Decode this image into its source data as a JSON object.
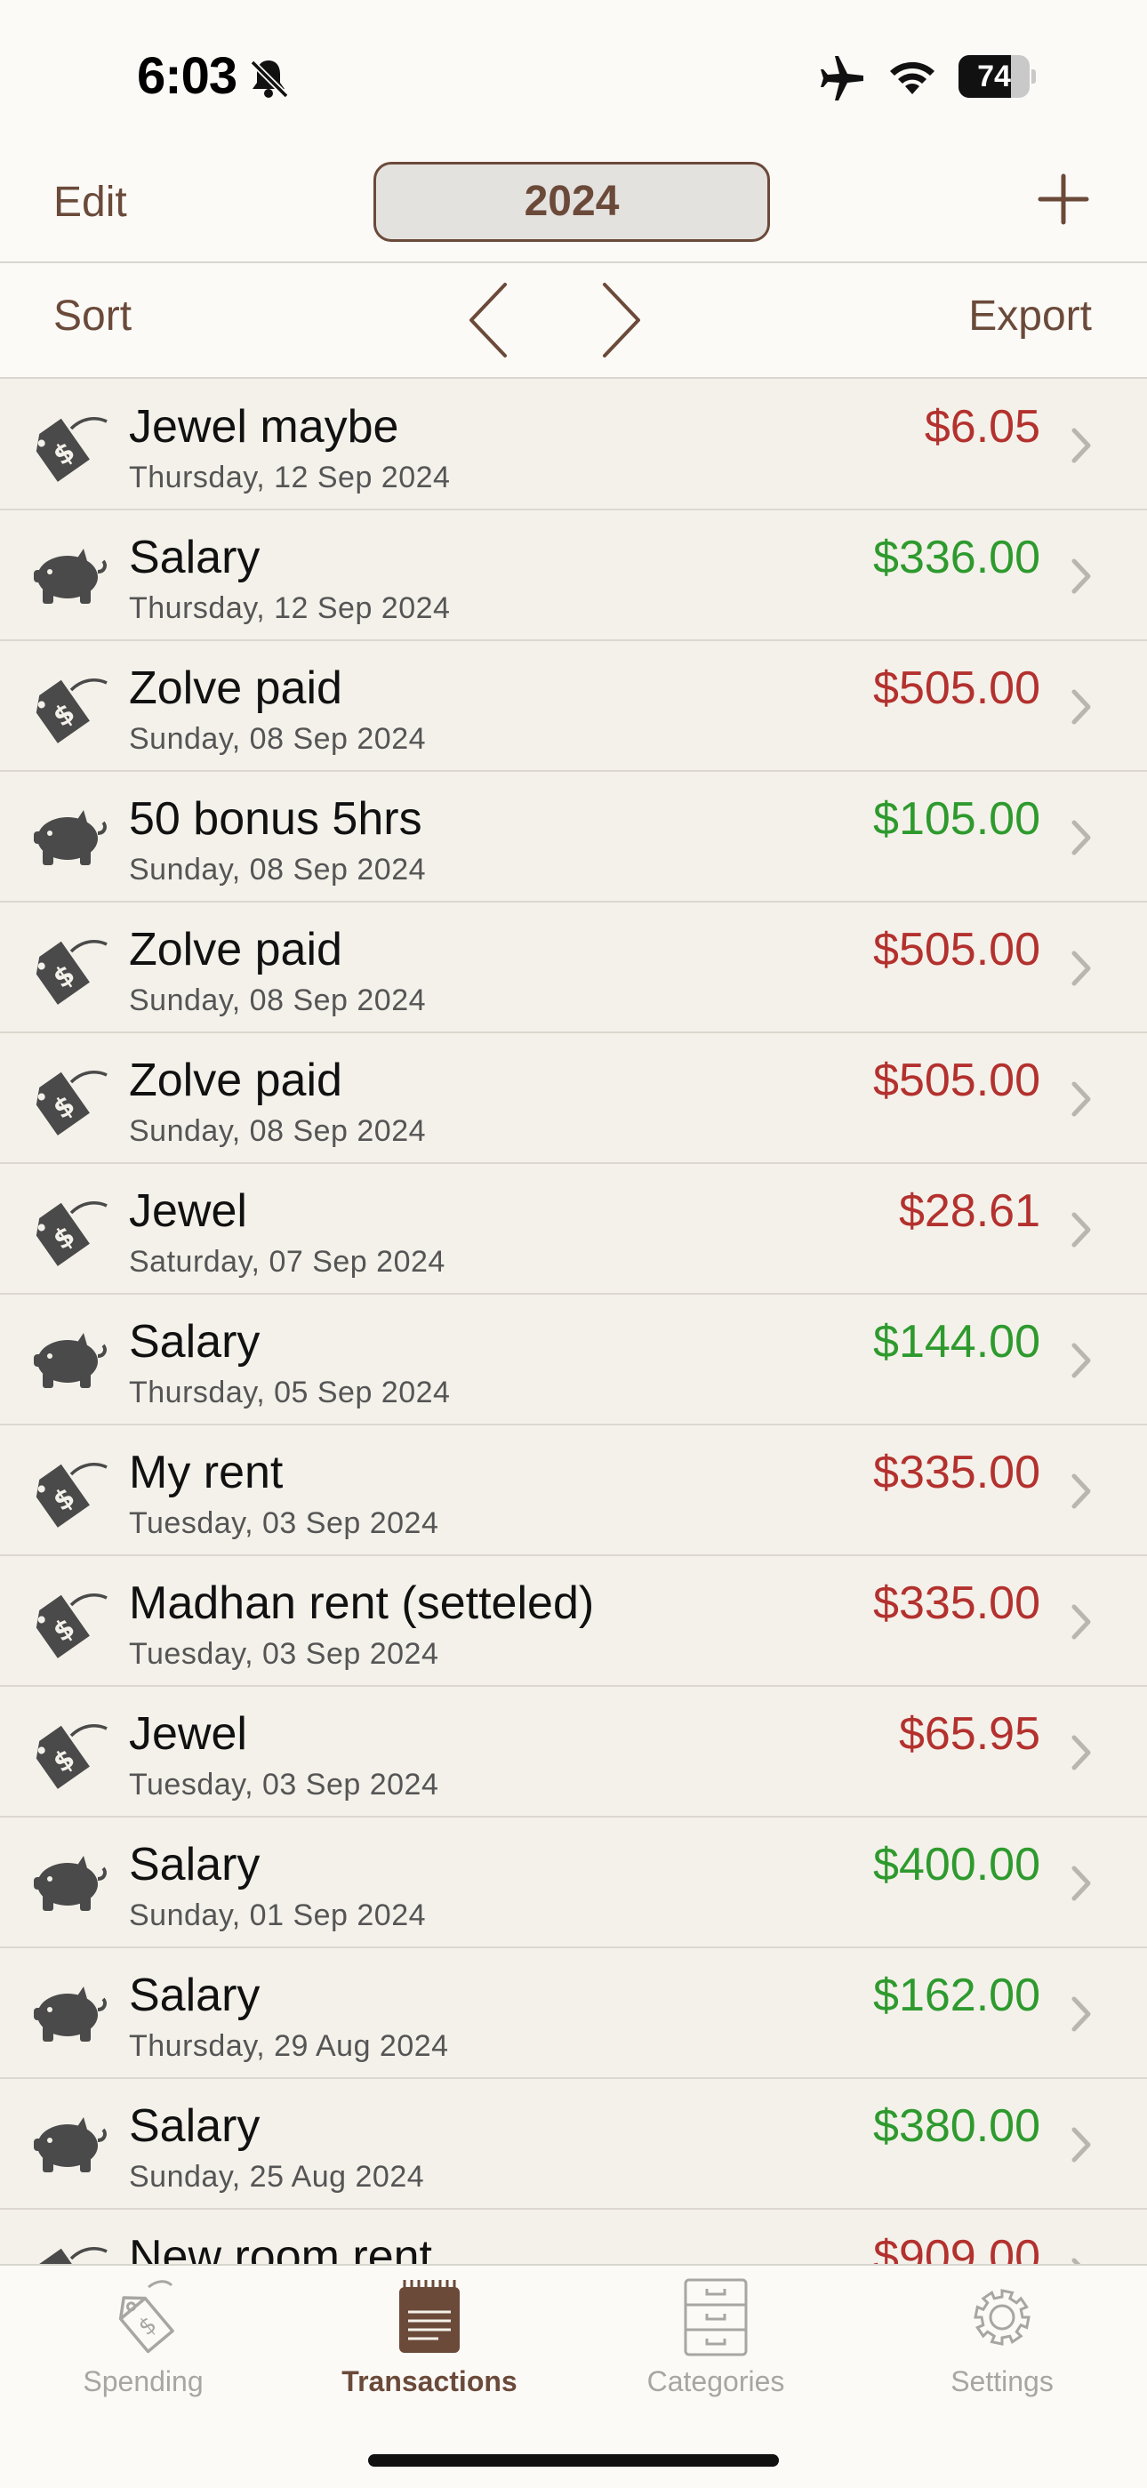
{
  "status_bar": {
    "time": "6:03",
    "battery_percent": "74",
    "battery_level": 0.74,
    "icons": [
      "bell-slash-icon",
      "airplane-icon",
      "wifi-icon",
      "battery-icon"
    ]
  },
  "nav": {
    "edit_label": "Edit",
    "year": "2024",
    "add_icon": "plus-icon"
  },
  "toolbar": {
    "sort_label": "Sort",
    "export_label": "Export",
    "prev_icon": "chevron-left-icon",
    "next_icon": "chevron-right-icon"
  },
  "colors": {
    "accent": "#6b4a3a",
    "expense": "#b3312e",
    "income": "#2e9a2e",
    "background": "#f4f1ea"
  },
  "transactions": [
    {
      "title": "Jewel maybe",
      "date": "Thursday, 12 Sep 2024",
      "amount": "$6.05",
      "type": "expense",
      "icon": "price-tag-icon"
    },
    {
      "title": "Salary",
      "date": "Thursday, 12 Sep 2024",
      "amount": "$336.00",
      "type": "income",
      "icon": "piggy-bank-icon"
    },
    {
      "title": "Zolve paid",
      "date": "Sunday, 08 Sep 2024",
      "amount": "$505.00",
      "type": "expense",
      "icon": "price-tag-icon"
    },
    {
      "title": "50 bonus 5hrs",
      "date": "Sunday, 08 Sep 2024",
      "amount": "$105.00",
      "type": "income",
      "icon": "piggy-bank-icon"
    },
    {
      "title": "Zolve paid",
      "date": "Sunday, 08 Sep 2024",
      "amount": "$505.00",
      "type": "expense",
      "icon": "price-tag-icon"
    },
    {
      "title": "Zolve paid",
      "date": "Sunday, 08 Sep 2024",
      "amount": "$505.00",
      "type": "expense",
      "icon": "price-tag-icon"
    },
    {
      "title": "Jewel",
      "date": "Saturday, 07 Sep 2024",
      "amount": "$28.61",
      "type": "expense",
      "icon": "price-tag-icon"
    },
    {
      "title": "Salary",
      "date": "Thursday, 05 Sep 2024",
      "amount": "$144.00",
      "type": "income",
      "icon": "piggy-bank-icon"
    },
    {
      "title": "My rent",
      "date": "Tuesday, 03 Sep 2024",
      "amount": "$335.00",
      "type": "expense",
      "icon": "price-tag-icon"
    },
    {
      "title": "Madhan rent (setteled)",
      "date": "Tuesday, 03 Sep 2024",
      "amount": "$335.00",
      "type": "expense",
      "icon": "price-tag-icon"
    },
    {
      "title": "Jewel",
      "date": "Tuesday, 03 Sep 2024",
      "amount": "$65.95",
      "type": "expense",
      "icon": "price-tag-icon"
    },
    {
      "title": "Salary",
      "date": "Sunday, 01 Sep 2024",
      "amount": "$400.00",
      "type": "income",
      "icon": "piggy-bank-icon"
    },
    {
      "title": "Salary",
      "date": "Thursday, 29 Aug 2024",
      "amount": "$162.00",
      "type": "income",
      "icon": "piggy-bank-icon"
    },
    {
      "title": "Salary",
      "date": "Sunday, 25 Aug 2024",
      "amount": "$380.00",
      "type": "income",
      "icon": "piggy-bank-icon"
    },
    {
      "title": "New room rent",
      "date": "",
      "amount": "$909.00",
      "type": "expense",
      "icon": "price-tag-icon"
    }
  ],
  "tabbar": {
    "tabs": [
      {
        "label": "Spending",
        "icon": "price-tag-icon",
        "active": false
      },
      {
        "label": "Transactions",
        "icon": "notepad-icon",
        "active": true
      },
      {
        "label": "Categories",
        "icon": "file-cabinet-icon",
        "active": false
      },
      {
        "label": "Settings",
        "icon": "gear-icon",
        "active": false
      }
    ]
  }
}
